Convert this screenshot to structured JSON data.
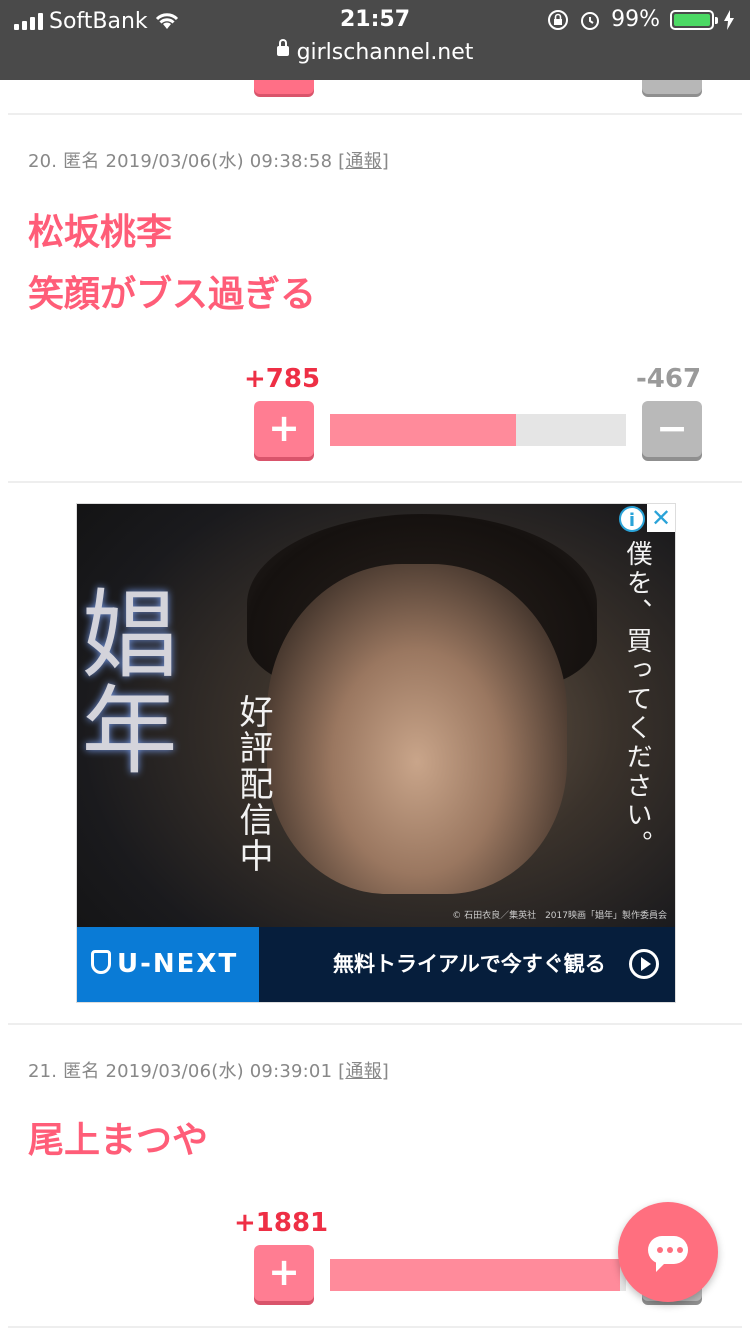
{
  "status_bar": {
    "carrier": "SoftBank",
    "time": "21:57",
    "battery": "99%",
    "url": "girlschannel.net"
  },
  "comments": [
    {
      "meta_prefix": "20. 匿名 2019/03/06(水) 09:38:58 [",
      "report": "通報",
      "meta_suffix": "]",
      "lines": [
        "松坂桃李",
        "笑顔がブス過ぎる"
      ],
      "plus": "+785",
      "minus": "-467",
      "plus_ratio": 0.63
    },
    {
      "meta_prefix": "21. 匿名 2019/03/06(水) 09:39:01 [",
      "report": "通報",
      "meta_suffix": "]",
      "lines": [
        "尾上まつや"
      ],
      "plus": "+1881",
      "plus_ratio": 0.98
    }
  ],
  "buttons": {
    "plus_symbol": "+",
    "minus_symbol": "−"
  },
  "ad": {
    "title": "娼年",
    "sub": "好評配信中",
    "copy": "僕を、買ってください。",
    "credit": "© 石田衣良／集英社　2017映画「娼年」製作委員会",
    "info": "i",
    "close": "✕",
    "brand": "U-NEXT",
    "cta": "無料トライアルで今すぐ観る"
  },
  "icons": {
    "wifi": "wifi-icon",
    "lock": "lock-icon",
    "chat": "chat-icon",
    "play": "play-icon"
  },
  "colors": {
    "accent": "#ff5d78",
    "plus": "#ee2f45",
    "minus": "#9a9a9a",
    "bar_fill": "#ff8b9b"
  }
}
